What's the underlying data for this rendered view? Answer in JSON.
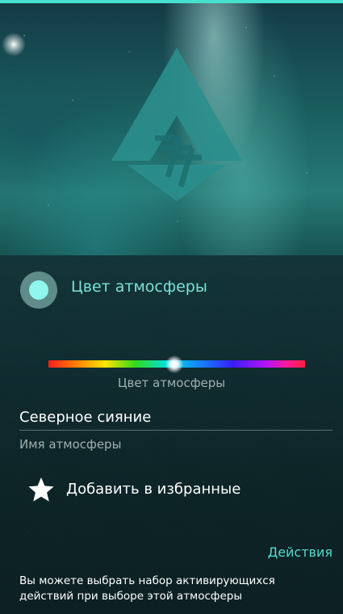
{
  "atmosphere_color": {
    "title": "Цвет атмосферы",
    "slider_caption": "Цвет атмосферы",
    "selected_color": "#8ff7ee",
    "slider_position_fraction": 0.49
  },
  "atmosphere_name": {
    "value": "Северное сияние",
    "caption": "Имя атмосферы"
  },
  "favorites": {
    "label": "Добавить в избранные",
    "icon": "star-icon"
  },
  "actions": {
    "title": "Действия",
    "description": "Вы можете выбрать набор активирующихся действий при выборе этой атмосферы"
  },
  "colors": {
    "accent": "#47e0cf",
    "accent_text": "#52dccf"
  }
}
